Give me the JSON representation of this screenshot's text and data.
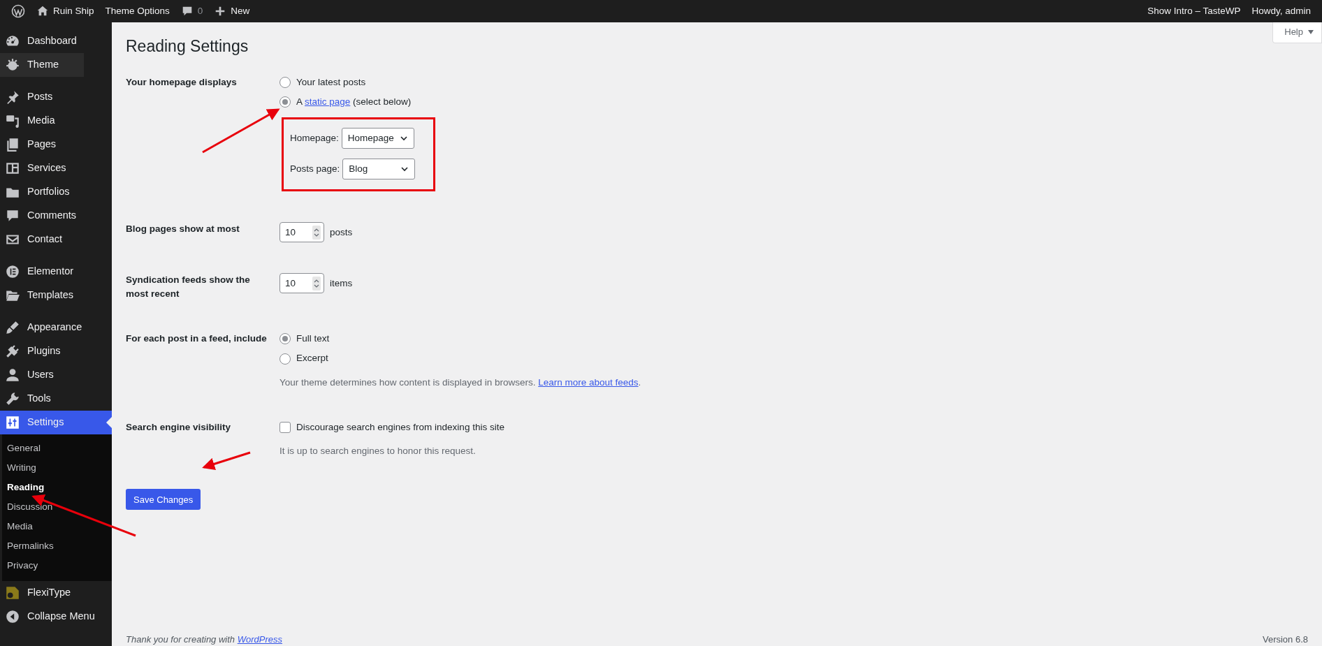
{
  "admin_bar": {
    "items": [
      {
        "kind": "logo"
      },
      {
        "kind": "home",
        "label": "Ruin Ship"
      },
      {
        "kind": "text",
        "label": "Theme Options"
      },
      {
        "kind": "comments",
        "label": "0"
      },
      {
        "kind": "new",
        "label": "New"
      }
    ],
    "right": [
      "Show Intro – TasteWP",
      "Howdy, admin"
    ]
  },
  "help_tab": {
    "label": "Help"
  },
  "sidebar": {
    "groups": [
      [
        {
          "label": "Dashboard",
          "kind": "dashboard",
          "selected": false,
          "hovered": false
        },
        {
          "label": "Theme",
          "kind": "theme",
          "selected": false,
          "hovered": true
        }
      ],
      [
        {
          "label": "Posts",
          "kind": "posts",
          "selected": false,
          "hovered": false
        },
        {
          "label": "Media",
          "kind": "media",
          "selected": false,
          "hovered": false
        },
        {
          "label": "Pages",
          "kind": "pages",
          "selected": false,
          "hovered": false
        },
        {
          "label": "Services",
          "kind": "services",
          "selected": false,
          "hovered": false
        },
        {
          "label": "Portfolios",
          "kind": "portfolios",
          "selected": false,
          "hovered": false
        },
        {
          "label": "Comments",
          "kind": "comments",
          "selected": false,
          "hovered": false
        },
        {
          "label": "Contact",
          "kind": "contact",
          "selected": false,
          "hovered": false
        }
      ],
      [
        {
          "label": "Elementor",
          "kind": "elementor",
          "selected": false,
          "hovered": false
        },
        {
          "label": "Templates",
          "kind": "templates",
          "selected": false,
          "hovered": false
        }
      ],
      [
        {
          "label": "Appearance",
          "kind": "appearance",
          "selected": false,
          "hovered": false
        },
        {
          "label": "Plugins",
          "kind": "plugins",
          "selected": false,
          "hovered": false
        },
        {
          "label": "Users",
          "kind": "users",
          "selected": false,
          "hovered": false
        },
        {
          "label": "Tools",
          "kind": "tools",
          "selected": false,
          "hovered": false
        },
        {
          "label": "Settings",
          "kind": "settings",
          "selected": true,
          "hovered": false,
          "submenu": [
            {
              "label": "General",
              "selected": false
            },
            {
              "label": "Writing",
              "selected": false
            },
            {
              "label": "Reading",
              "selected": true
            },
            {
              "label": "Discussion",
              "selected": false
            },
            {
              "label": "Media",
              "selected": false
            },
            {
              "label": "Permalinks",
              "selected": false
            },
            {
              "label": "Privacy",
              "selected": false
            }
          ]
        },
        {
          "label": "FlexiType",
          "kind": "flexitype",
          "selected": false,
          "hovered": false
        },
        {
          "label": "Collapse Menu",
          "kind": "collapse",
          "selected": false,
          "hovered": false
        }
      ]
    ]
  },
  "page": {
    "title": "Reading Settings",
    "rows": [
      {
        "kind": "radios",
        "label": "Your homepage displays",
        "options": [
          {
            "label": "Your latest posts",
            "selected": false
          },
          {
            "before": "A",
            "link": "static page",
            "after": "(select below)",
            "selected": true
          }
        ],
        "selects": [
          {
            "label": "Homepage:",
            "value": "Homepage"
          },
          {
            "label": "Posts page:",
            "value": "Blog"
          }
        ]
      },
      {
        "kind": "number",
        "label": "Blog pages show at most",
        "value": "10",
        "unit": "posts"
      },
      {
        "kind": "number",
        "label": "Syndication feeds show the most recent",
        "value": "10",
        "unit": "items"
      },
      {
        "kind": "radios",
        "label": "For each post in a feed, include",
        "options": [
          {
            "label": "Full text",
            "selected": true
          },
          {
            "label": "Excerpt",
            "selected": false
          }
        ],
        "description": {
          "text": "Your theme determines how content is displayed in browsers.",
          "link": "Learn more about feeds",
          "after": "."
        }
      },
      {
        "kind": "checkbox",
        "label": "Search engine visibility",
        "option": "Discourage search engines from indexing this site",
        "checked": false,
        "description": {
          "text": "It is up to search engines to honor this request."
        }
      }
    ],
    "button": "Save Changes"
  },
  "footer": {
    "text": "Thank you for creating with",
    "link": "WordPress",
    "version": "Version 6.8"
  }
}
